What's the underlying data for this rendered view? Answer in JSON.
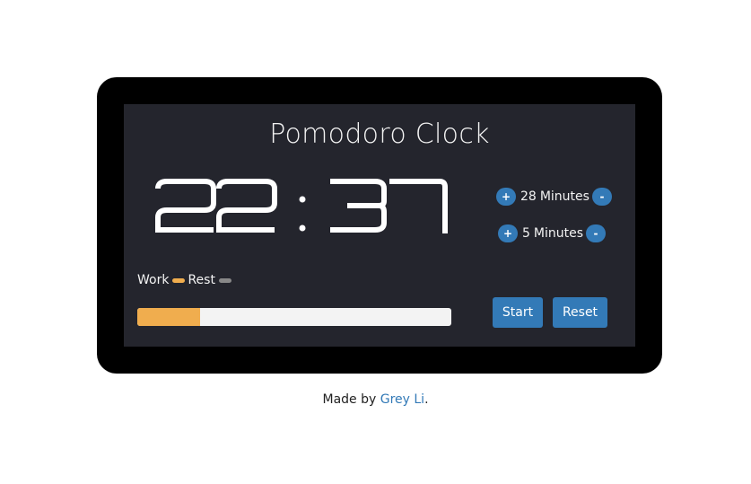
{
  "app": {
    "title": "Pomodoro Clock"
  },
  "clock": {
    "display": "22 : 37",
    "minutes": "22",
    "separator": ":",
    "seconds": "37"
  },
  "settings": {
    "work": {
      "increase_label": "+",
      "value": "28",
      "unit": "Minutes",
      "decrease_label": "-"
    },
    "rest": {
      "increase_label": "+",
      "value": "5",
      "unit": "Minutes",
      "decrease_label": "-"
    }
  },
  "legend": {
    "work_label": "Work",
    "work_color": "#f0ad4e",
    "rest_label": "Rest",
    "rest_color": "#888888"
  },
  "progress": {
    "fraction": 0.2,
    "fill_color": "#f0ad4e"
  },
  "controls": {
    "start_label": "Start",
    "reset_label": "Reset"
  },
  "footer": {
    "prefix": "Made by ",
    "author": "Grey Li",
    "suffix": "."
  },
  "colors": {
    "accent": "#337ab7",
    "panel_bg": "#24252d",
    "frame_bg": "#000000"
  }
}
